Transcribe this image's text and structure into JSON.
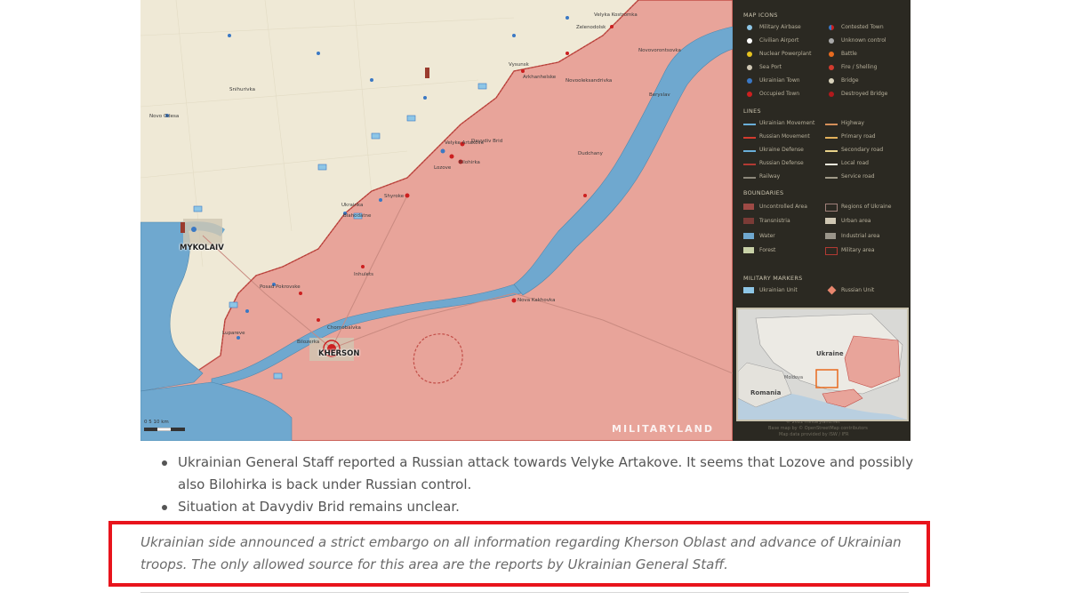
{
  "map": {
    "cities": {
      "mykolaiv": "MYKOLAIV",
      "kherson": "KHERSON"
    },
    "places": [
      "Velyke Artakove",
      "Davydiv Brid",
      "Novo Odesa",
      "Snihurivka",
      "Bilohirka",
      "Dudchany",
      "Nova Kakhovka",
      "Chornobaivka",
      "Bilozerka",
      "Zelenodolsk",
      "Velyka Kostromka",
      "Novovorontsovka",
      "Beryslav",
      "Posad Pokrovske",
      "Lupareve",
      "Ukrainka",
      "Shyroke",
      "Blahodatne",
      "Vysunsk",
      "Arkhanhelske",
      "Novooleksandrivka",
      "Inhulets",
      "Lozove"
    ],
    "scale_label": "0     5     10 km",
    "watermark": "MILITARYLAND"
  },
  "legend": {
    "map_icons_title": "MAP ICONS",
    "map_icons": [
      "Military Airbase",
      "Civilian Airport",
      "Nuclear Powerplant",
      "Sea Port",
      "Ukrainian Town",
      "Occupied Town"
    ],
    "map_icons_right": [
      "Contested Town",
      "Unknown control",
      "Battle",
      "Fire / Shelling",
      "Bridge",
      "Destroyed Bridge"
    ],
    "lines_title": "LINES",
    "lines": [
      "Ukrainian Movement",
      "Russian Movement",
      "Ukraine Defense",
      "Russian Defense",
      "Railway"
    ],
    "lines_right": [
      "Highway",
      "Primary road",
      "Secondary road",
      "Local road",
      "Service road"
    ],
    "boundaries_title": "BOUNDARIES",
    "boundaries": [
      "Uncontrolled Area",
      "Transnistria",
      "Water",
      "Forest"
    ],
    "boundaries_right": [
      "Regions of Ukraine",
      "Urban area",
      "Industrial area",
      "Military area"
    ],
    "markers_title": "MILITARY MARKERS",
    "markers": [
      "Ukrainian Unit",
      "Russian Unit"
    ],
    "inset": {
      "ukraine": "Ukraine",
      "romania": "Romania",
      "moldova": "Moldova"
    },
    "footer": [
      "© 2022 militaryland.net",
      "Base map by © OpenStreetMap contributors",
      "Map data provided by ISW / IFR"
    ]
  },
  "content": {
    "bullets": [
      "Ukrainian General Staff reported a Russian attack towards Velyke Artakove. It seems that Lozove and possibly also Bilohirka is back under Russian control.",
      "Situation at Davydiv Brid remains unclear."
    ],
    "note": "Ukrainian side announced a strict embargo on all information regarding Kherson Oblast and advance of Ukrainian troops. The only allowed source for this area are the reports by Ukrainian General Staff."
  },
  "colors": {
    "occupied_area": "#e8a49a",
    "water": "#6fa8cf",
    "land": "#efe9d6",
    "legend_bg": "#2b2922",
    "highlight_border": "#e8141c"
  }
}
